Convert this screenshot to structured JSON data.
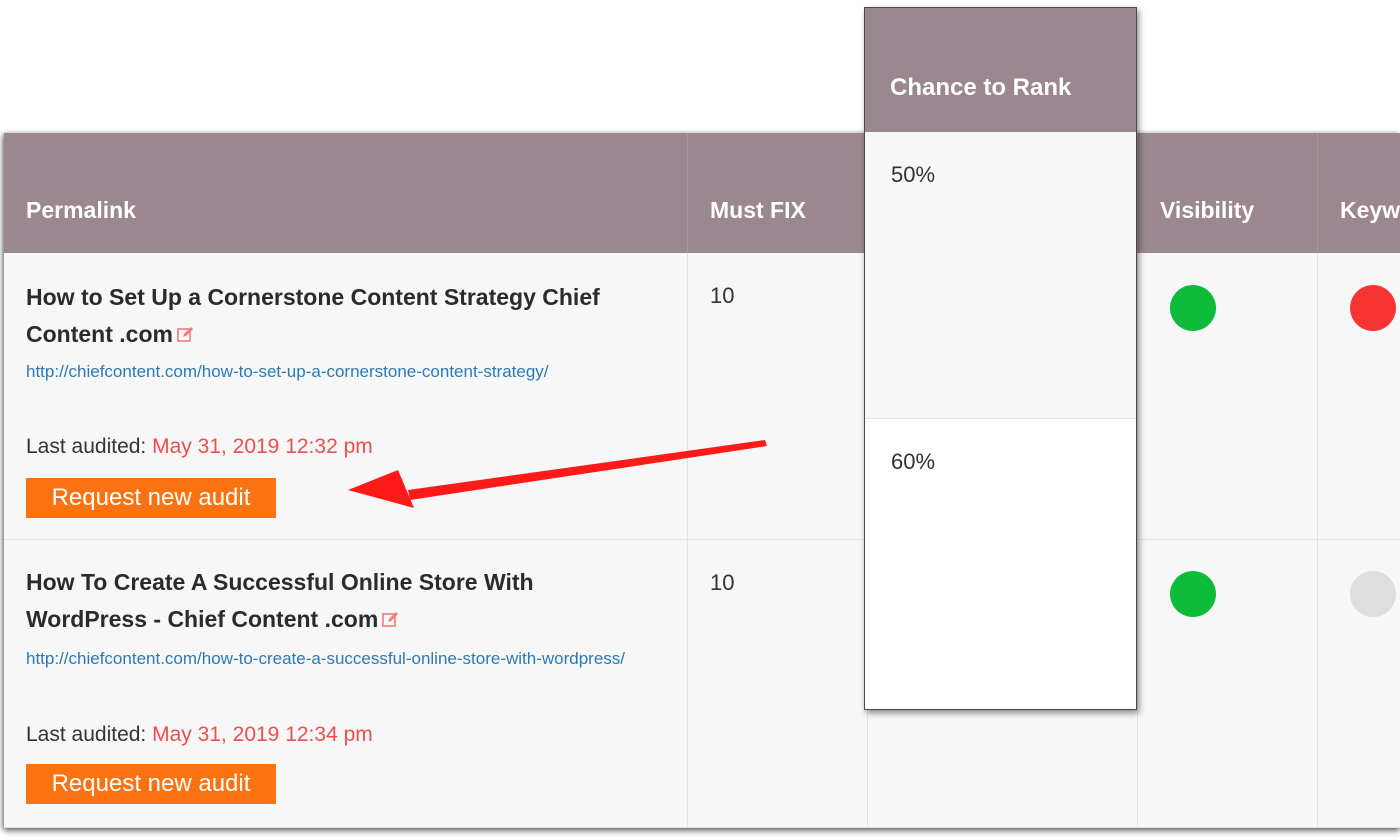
{
  "table": {
    "headers": {
      "permalink": "Permalink",
      "must_fix": "Must FIX",
      "visibility": "Visibility",
      "keywords_partial": "Keyw"
    },
    "rows": [
      {
        "title": "How to Set Up a Cornerstone Content Strategy Chief Content .com",
        "url": "http://chiefcontent.com/how-to-set-up-a-cornerstone-content-strategy/",
        "last_audited_label": "Last audited:",
        "last_audited_value": "May 31, 2019 12:32 pm",
        "button_label": "Request new audit",
        "must_fix": "10",
        "visibility_status": "good",
        "keywords_status": "bad"
      },
      {
        "title": "How To Create A Successful Online Store With WordPress - Chief Content .com",
        "url": "http://chiefcontent.com/how-to-create-a-successful-online-store-with-wordpress/",
        "last_audited_label": "Last audited:",
        "last_audited_value": "May 31, 2019 12:34 pm",
        "button_label": "Request new audit",
        "must_fix": "10",
        "visibility_status": "good",
        "keywords_status": "none"
      }
    ]
  },
  "popup": {
    "header": "Chance to Rank",
    "values": [
      "50%",
      "60%"
    ]
  },
  "colors": {
    "header_bg": "#9b878f",
    "status_good": "#0dbb3a",
    "status_bad": "#f73535",
    "status_none": "#dedede",
    "button": "#fb7211",
    "date": "#ef4e4e",
    "link": "#2a7ab8",
    "arrow": "#ff0000"
  },
  "icons": {
    "edit": "edit-icon",
    "arrow": "red-arrow-annotation"
  }
}
